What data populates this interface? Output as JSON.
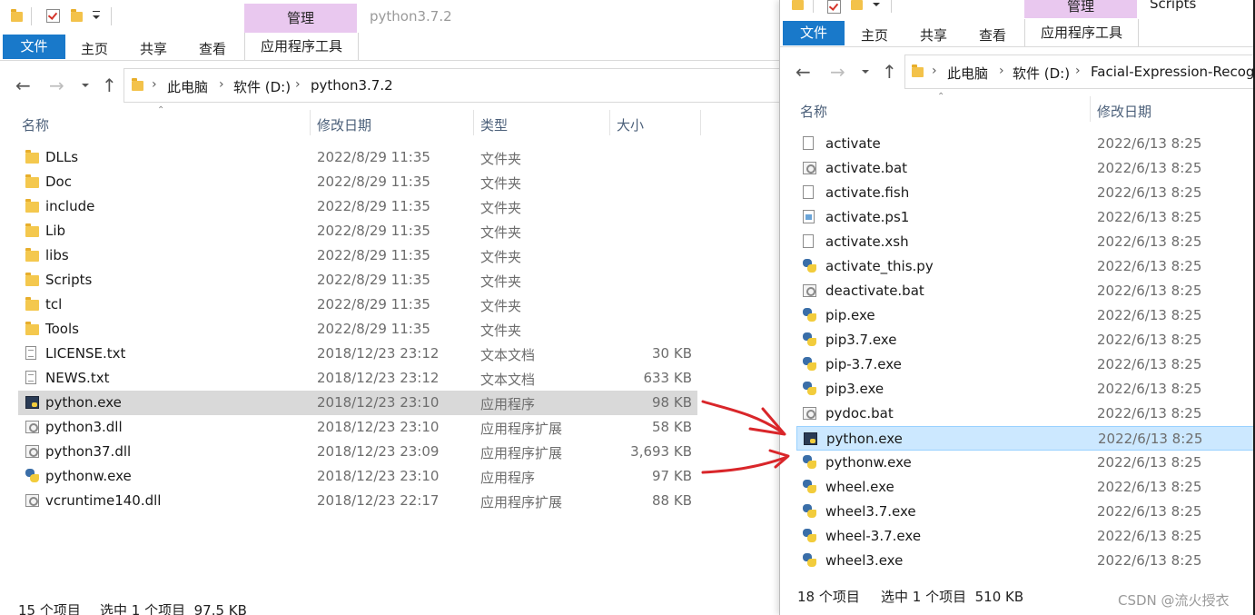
{
  "left": {
    "title": "python3.7.2",
    "manage_tab": "管理",
    "ribbon_tabs": [
      "文件",
      "主页",
      "共享",
      "查看",
      "应用程序工具"
    ],
    "breadcrumb": [
      "此电脑",
      "软件 (D:)",
      "python3.7.2"
    ],
    "columns": [
      "名称",
      "修改日期",
      "类型",
      "大小"
    ],
    "files": [
      {
        "name": "DLLs",
        "date": "2022/8/29 11:35",
        "type": "文件夹",
        "size": "",
        "icon": "folder-icon"
      },
      {
        "name": "Doc",
        "date": "2022/8/29 11:35",
        "type": "文件夹",
        "size": "",
        "icon": "folder-icon"
      },
      {
        "name": "include",
        "date": "2022/8/29 11:35",
        "type": "文件夹",
        "size": "",
        "icon": "folder-icon"
      },
      {
        "name": "Lib",
        "date": "2022/8/29 11:35",
        "type": "文件夹",
        "size": "",
        "icon": "folder-icon"
      },
      {
        "name": "libs",
        "date": "2022/8/29 11:35",
        "type": "文件夹",
        "size": "",
        "icon": "folder-icon"
      },
      {
        "name": "Scripts",
        "date": "2022/8/29 11:35",
        "type": "文件夹",
        "size": "",
        "icon": "folder-icon"
      },
      {
        "name": "tcl",
        "date": "2022/8/29 11:35",
        "type": "文件夹",
        "size": "",
        "icon": "folder-icon"
      },
      {
        "name": "Tools",
        "date": "2022/8/29 11:35",
        "type": "文件夹",
        "size": "",
        "icon": "folder-icon"
      },
      {
        "name": "LICENSE.txt",
        "date": "2018/12/23 23:12",
        "type": "文本文档",
        "size": "30 KB",
        "icon": "text-file-icon"
      },
      {
        "name": "NEWS.txt",
        "date": "2018/12/23 23:12",
        "type": "文本文档",
        "size": "633 KB",
        "icon": "text-file-icon"
      },
      {
        "name": "python.exe",
        "date": "2018/12/23 23:10",
        "type": "应用程序",
        "size": "98 KB",
        "icon": "python-exe-icon",
        "selected": true
      },
      {
        "name": "python3.dll",
        "date": "2018/12/23 23:10",
        "type": "应用程序扩展",
        "size": "58 KB",
        "icon": "dll-gear-icon"
      },
      {
        "name": "python37.dll",
        "date": "2018/12/23 23:09",
        "type": "应用程序扩展",
        "size": "3,693 KB",
        "icon": "dll-gear-icon"
      },
      {
        "name": "pythonw.exe",
        "date": "2018/12/23 23:10",
        "type": "应用程序",
        "size": "97 KB",
        "icon": "python-logo-icon"
      },
      {
        "name": "vcruntime140.dll",
        "date": "2018/12/23 22:17",
        "type": "应用程序扩展",
        "size": "88 KB",
        "icon": "dll-gear-icon"
      }
    ],
    "status": {
      "count": "15 个项目",
      "selected": "选中 1 个项目  97.5 KB"
    }
  },
  "right": {
    "title": "Scripts",
    "manage_tab": "管理",
    "ribbon_tabs": [
      "文件",
      "主页",
      "共享",
      "查看",
      "应用程序工具"
    ],
    "breadcrumb": [
      "此电脑",
      "软件 (D:)",
      "Facial-Expression-Recogn"
    ],
    "columns": [
      "名称",
      "修改日期"
    ],
    "files": [
      {
        "name": "activate",
        "date": "2022/6/13 8:25",
        "icon": "blank-file-icon"
      },
      {
        "name": "activate.bat",
        "date": "2022/6/13 8:25",
        "icon": "bat-gear-icon"
      },
      {
        "name": "activate.fish",
        "date": "2022/6/13 8:25",
        "icon": "blank-file-icon"
      },
      {
        "name": "activate.ps1",
        "date": "2022/6/13 8:25",
        "icon": "powershell-file-icon"
      },
      {
        "name": "activate.xsh",
        "date": "2022/6/13 8:25",
        "icon": "blank-file-icon"
      },
      {
        "name": "activate_this.py",
        "date": "2022/6/13 8:25",
        "icon": "python-file-icon"
      },
      {
        "name": "deactivate.bat",
        "date": "2022/6/13 8:25",
        "icon": "bat-gear-icon"
      },
      {
        "name": "pip.exe",
        "date": "2022/6/13 8:25",
        "icon": "python-logo-icon"
      },
      {
        "name": "pip3.7.exe",
        "date": "2022/6/13 8:25",
        "icon": "python-logo-icon"
      },
      {
        "name": "pip-3.7.exe",
        "date": "2022/6/13 8:25",
        "icon": "python-logo-icon"
      },
      {
        "name": "pip3.exe",
        "date": "2022/6/13 8:25",
        "icon": "python-logo-icon"
      },
      {
        "name": "pydoc.bat",
        "date": "2022/6/13 8:25",
        "icon": "bat-gear-icon"
      },
      {
        "name": "python.exe",
        "date": "2022/6/13 8:25",
        "icon": "python-exe-icon",
        "selected": true
      },
      {
        "name": "pythonw.exe",
        "date": "2022/6/13 8:25",
        "icon": "python-logo-icon"
      },
      {
        "name": "wheel.exe",
        "date": "2022/6/13 8:25",
        "icon": "python-logo-icon"
      },
      {
        "name": "wheel3.7.exe",
        "date": "2022/6/13 8:25",
        "icon": "python-logo-icon"
      },
      {
        "name": "wheel-3.7.exe",
        "date": "2022/6/13 8:25",
        "icon": "python-logo-icon"
      },
      {
        "name": "wheel3.exe",
        "date": "2022/6/13 8:25",
        "icon": "python-logo-icon"
      }
    ],
    "status": {
      "count": "18 个项目",
      "selected": "选中 1 个项目  510 KB"
    }
  },
  "watermark": "CSDN @流火授衣",
  "colors": {
    "accent": "#1979ca",
    "manage_tab": "#e9c8ef",
    "arrow": "#d9262a",
    "selected_blue": "#cce8ff",
    "selected_gray": "#d9d9d9"
  }
}
